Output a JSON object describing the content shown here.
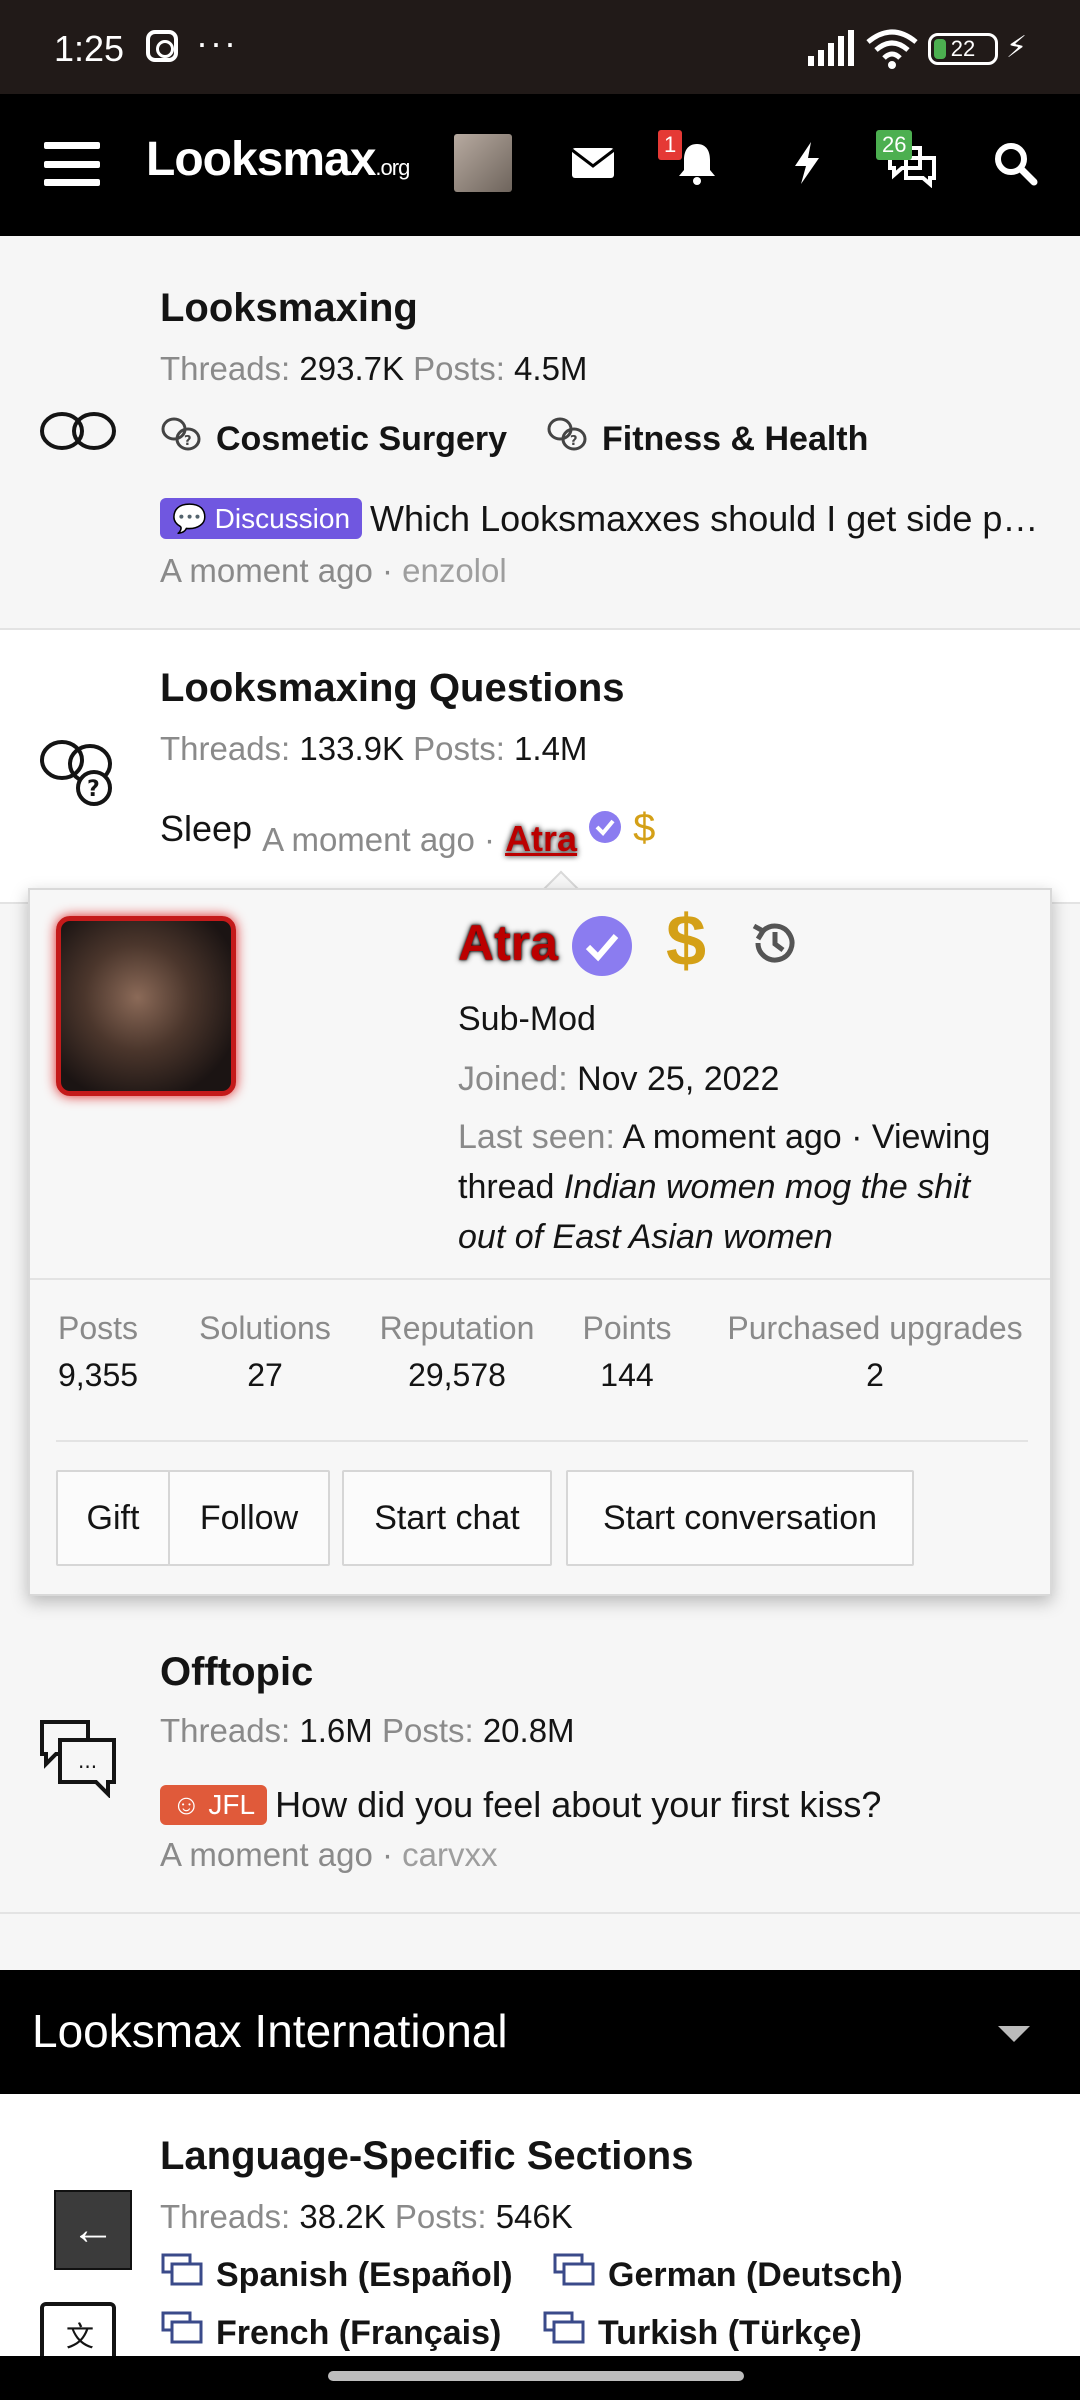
{
  "status_bar": {
    "time": "1:25",
    "dots": "···",
    "battery": "22"
  },
  "navbar": {
    "logo": "Looksmax",
    "logo_suffix": ".org",
    "notification_count": "1",
    "chat_count": "26"
  },
  "forums": [
    {
      "title": "Looksmaxing",
      "threads_label": "Threads:",
      "threads": "293.7K",
      "posts_label": "Posts:",
      "posts": "4.5M",
      "subforums": [
        "Cosmetic Surgery",
        "Fitness & Health"
      ],
      "latest_tag": "Discussion",
      "latest_title": "Which Looksmaxxes should I get side pr…",
      "latest_time": "A moment ago",
      "latest_user": "enzolol"
    },
    {
      "title": "Looksmaxing Questions",
      "threads_label": "Threads:",
      "threads": "133.9K",
      "posts_label": "Posts:",
      "posts": "1.4M",
      "latest_title": "Sleep",
      "latest_time": "A moment ago ·",
      "latest_user": "Atra"
    },
    {
      "title": "Offtopic",
      "threads_label": "Threads:",
      "threads": "1.6M",
      "posts_label": "Posts:",
      "posts": "20.8M",
      "latest_tag": "JFL",
      "latest_title": "How did you feel about your first kiss?",
      "latest_time": "A moment ago",
      "latest_user": "carvxx"
    },
    {
      "title": "Language-Specific Sections",
      "threads_label": "Threads:",
      "threads": "38.2K",
      "posts_label": "Posts:",
      "posts": "546K",
      "subforums": [
        "Spanish (Español)",
        "German (Deutsch)",
        "French (Français)",
        "Turkish (Türkçe)"
      ]
    }
  ],
  "profile_popup": {
    "username": "Atra",
    "role": "Sub-Mod",
    "joined_label": "Joined:",
    "joined": "Nov 25, 2022",
    "last_seen_label": "Last seen:",
    "last_seen": "A moment ago · Viewing",
    "viewing_prefix": "thread",
    "viewing_thread": "Indian women mog the shit",
    "viewing_thread_2": "out of East Asian women",
    "stats": [
      {
        "label": "Posts",
        "value": "9,355"
      },
      {
        "label": "Solutions",
        "value": "27"
      },
      {
        "label": "Reputation",
        "value": "29,578"
      },
      {
        "label": "Points",
        "value": "144"
      },
      {
        "label": "Purchased upgrades",
        "value": "2"
      }
    ],
    "buttons": [
      "Gift",
      "Follow",
      "Start chat",
      "Start conversation"
    ]
  },
  "section": {
    "title": "Looksmax International"
  },
  "colors": {
    "accent_purple": "#7057e0",
    "jfl_orange": "#e05a3a",
    "username_red": "#b00000",
    "badge_red": "#e53935",
    "badge_green": "#4caf50"
  },
  "icons": [
    "hamburger-icon",
    "mail-icon",
    "bell-icon",
    "bolt-icon",
    "chat-icon",
    "search-icon",
    "verified-icon",
    "dollar-icon",
    "history-icon",
    "back-arrow-icon"
  ]
}
